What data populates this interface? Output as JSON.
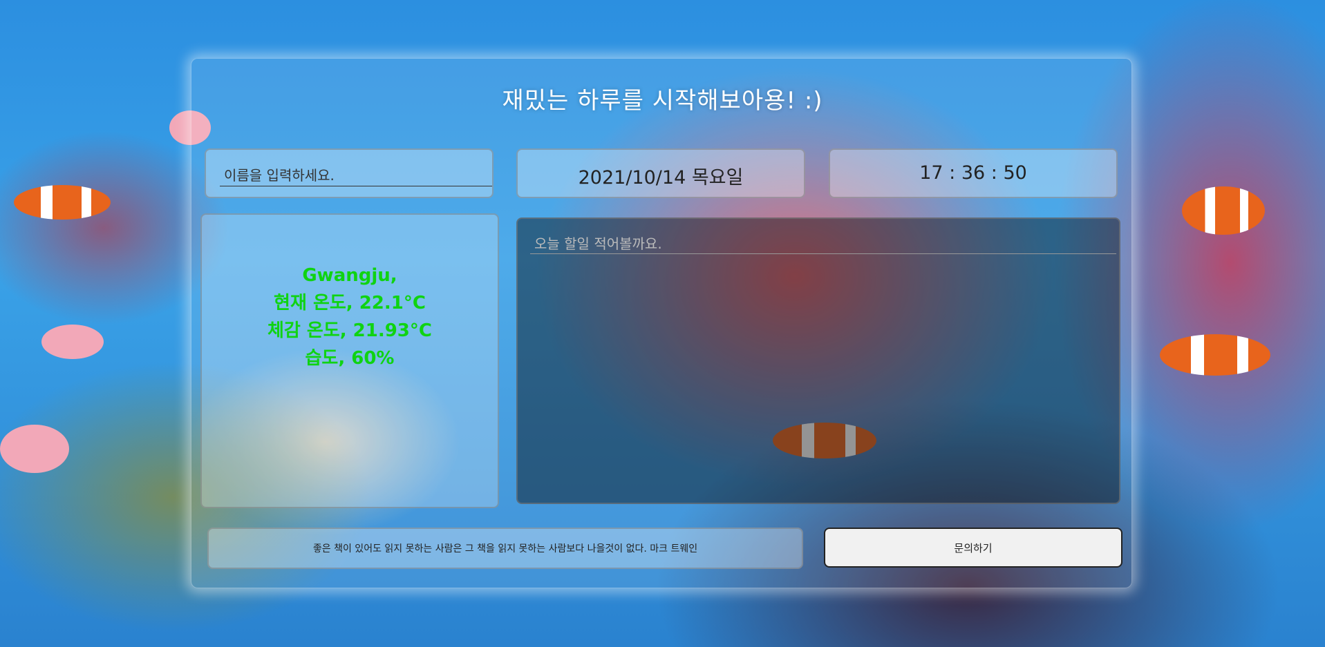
{
  "header": {
    "title": "재밌는 하루를 시작해보아용! :)"
  },
  "name": {
    "placeholder": "이름을 입력하세요."
  },
  "datetime": {
    "date": "2021/10/14 목요일",
    "time": "17 : 36 : 50"
  },
  "weather": {
    "city": "Gwangju,",
    "current": "현재 온도, 22.1°C",
    "feels_like": "체감 온도, 21.93°C",
    "humidity": "습도, 60%",
    "text_color": "#0fd312"
  },
  "todo": {
    "placeholder": "오늘 할일 적어볼까요."
  },
  "quote": {
    "text": "좋은 책이 있어도 읽지 못하는 사람은 그 책을 읽지 못하는 사람보다 나을것이 없다. 마크 트웨인"
  },
  "contact": {
    "label": "문의하기"
  }
}
